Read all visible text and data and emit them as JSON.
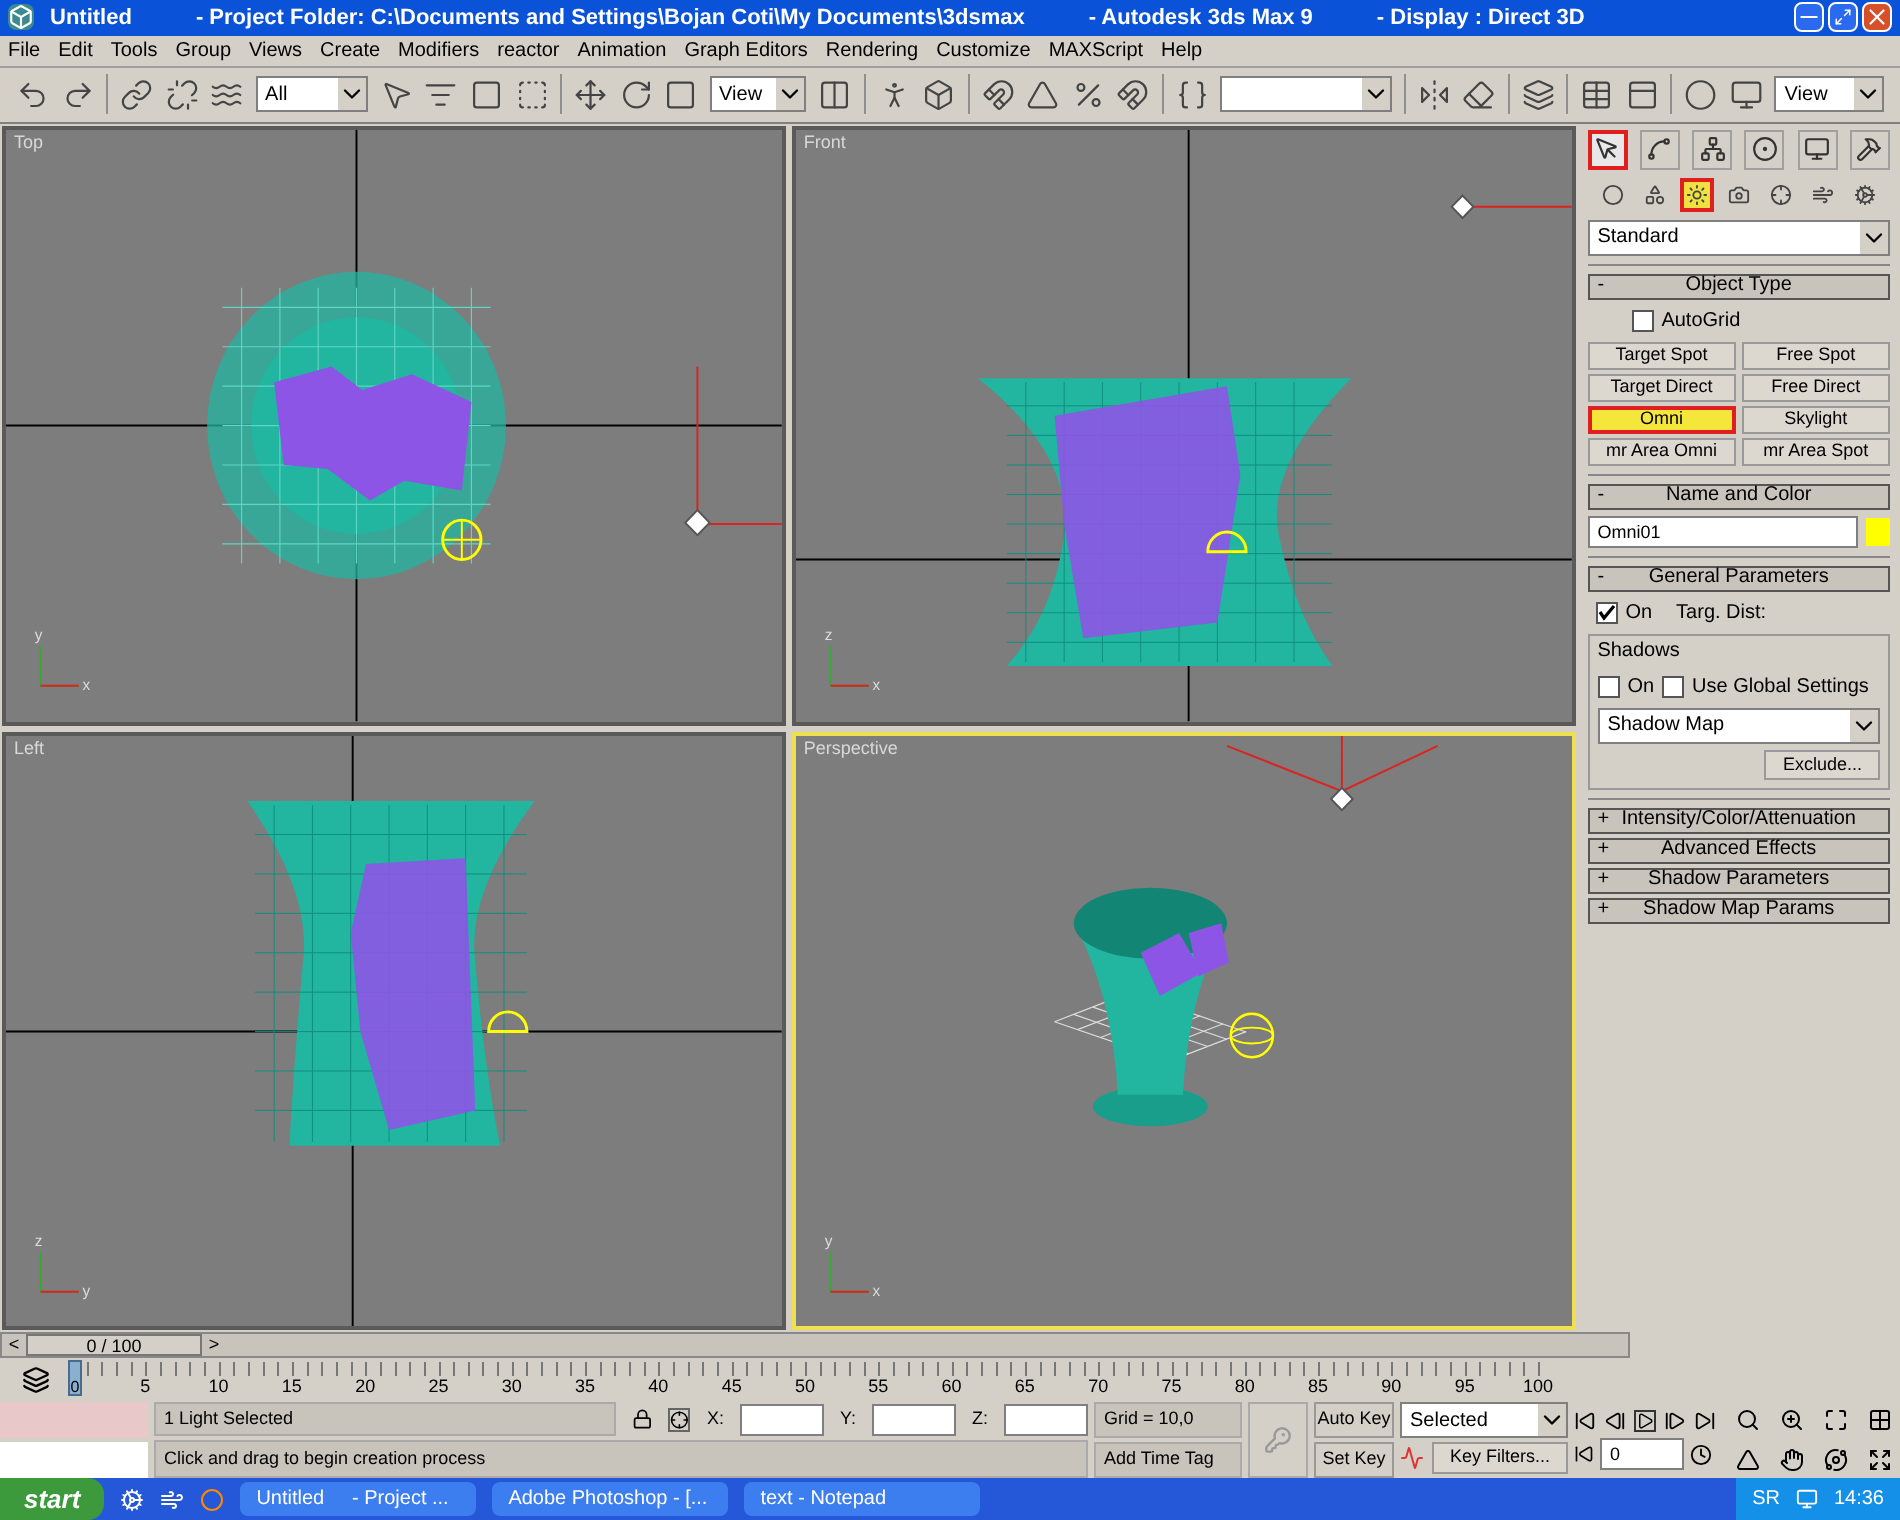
{
  "window": {
    "title": "Untitled",
    "project": "- Project Folder: C:\\Documents and Settings\\Bojan Coti\\My Documents\\3dsmax",
    "app": "- Autodesk 3ds Max 9",
    "display": "- Display : Direct 3D"
  },
  "menu": [
    "File",
    "Edit",
    "Tools",
    "Group",
    "Views",
    "Create",
    "Modifiers",
    "reactor",
    "Animation",
    "Graph Editors",
    "Rendering",
    "Customize",
    "MAXScript",
    "Help"
  ],
  "toolbar": {
    "selection_filter": "All",
    "reference_coords": "View",
    "render_view": "View"
  },
  "viewports": [
    {
      "label": "Top",
      "kind": "top",
      "active": false,
      "axes": [
        "x",
        "y"
      ]
    },
    {
      "label": "Front",
      "kind": "front",
      "active": false,
      "axes": [
        "x",
        "z"
      ]
    },
    {
      "label": "Left",
      "kind": "left",
      "active": false,
      "axes": [
        "y",
        "z"
      ]
    },
    {
      "label": "Perspective",
      "kind": "perspective",
      "active": true,
      "axes": [
        "x",
        "y"
      ]
    }
  ],
  "command_panel": {
    "tabs": [
      {
        "selected": true
      },
      {
        "selected": false
      },
      {
        "selected": false
      },
      {
        "selected": false
      },
      {
        "selected": false
      },
      {
        "selected": false
      }
    ],
    "categories": [
      {
        "selected": false
      },
      {
        "selected": false
      },
      {
        "selected": true
      },
      {
        "selected": false
      },
      {
        "selected": false
      },
      {
        "selected": false
      },
      {
        "selected": false
      }
    ],
    "subcategory": "Standard",
    "object_type": {
      "sign": "-",
      "title": "Object Type",
      "autogrid": {
        "label": "AutoGrid",
        "checked": false
      },
      "buttons": [
        {
          "label": "Target Spot",
          "selected": false
        },
        {
          "label": "Free Spot",
          "selected": false
        },
        {
          "label": "Target Direct",
          "selected": false
        },
        {
          "label": "Free Direct",
          "selected": false
        },
        {
          "label": "Omni",
          "selected": true
        },
        {
          "label": "Skylight",
          "selected": false
        },
        {
          "label": "mr Area Omni",
          "selected": false
        },
        {
          "label": "mr Area Spot",
          "selected": false
        }
      ]
    },
    "name_and_color": {
      "sign": "-",
      "title": "Name and Color",
      "name": "Omni01",
      "color": "#ffff00"
    },
    "general_parameters": {
      "sign": "-",
      "title": "General Parameters",
      "on": {
        "label": "On",
        "checked": true
      },
      "targ_dist": "Targ. Dist:",
      "shadows_title": "Shadows",
      "shadows_on": {
        "label": "On",
        "checked": false
      },
      "global_settings": {
        "label": "Use Global Settings",
        "checked": false
      },
      "shadow_type": "Shadow Map",
      "exclude": "Exclude..."
    },
    "rollouts": [
      {
        "sign": "+",
        "title": "Intensity/Color/Attenuation"
      },
      {
        "sign": "+",
        "title": "Advanced Effects"
      },
      {
        "sign": "+",
        "title": "Shadow Parameters"
      },
      {
        "sign": "+",
        "title": "Shadow Map Params"
      }
    ]
  },
  "time_slider": {
    "label": "0 / 100",
    "prev": "<",
    "next": ">"
  },
  "trackbar": {
    "frame": "0",
    "ticks": [
      "5",
      "10",
      "15",
      "20",
      "25",
      "30",
      "35",
      "40",
      "45",
      "50",
      "55",
      "60",
      "65",
      "70",
      "75",
      "80",
      "85",
      "90",
      "95",
      "100"
    ]
  },
  "status": {
    "selection": "1 Light Selected",
    "prompt": "Click and drag to begin creation process",
    "x_label": "X:",
    "y_label": "Y:",
    "z_label": "Z:",
    "grid": "Grid = 10,0",
    "time_tag": "Add Time Tag",
    "auto_key": "Auto Key",
    "set_key": "Set Key",
    "key_mode": "Selected",
    "key_filters": "Key Filters...",
    "current_frame": "0"
  },
  "taskbar": {
    "start": "start",
    "tasks": [
      {
        "label": "Untitled     - Project ...",
        "selected": false
      },
      {
        "label": "Adobe Photoshop - [...",
        "selected": false
      },
      {
        "label": "text - Notepad",
        "selected": false
      }
    ],
    "language": "SR",
    "clock": "14:36"
  }
}
